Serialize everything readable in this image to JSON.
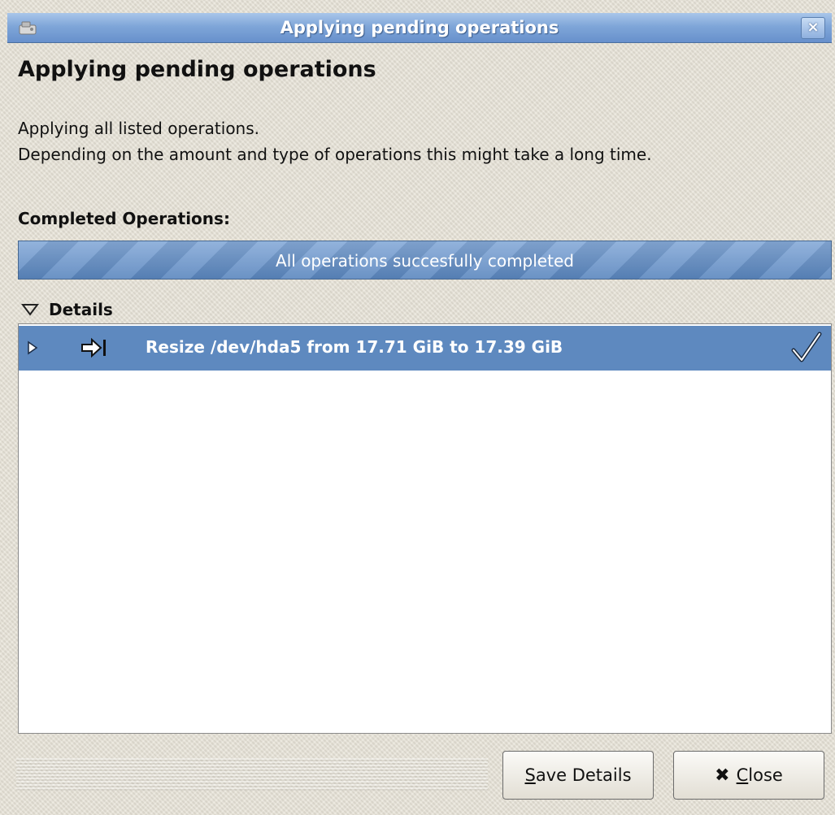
{
  "window": {
    "title": "Applying pending operations",
    "close_label": "×"
  },
  "dialog": {
    "heading": "Applying pending operations",
    "description_line1": "Applying all listed operations.",
    "description_line2": "Depending on the amount and type of operations this might take a long time."
  },
  "completed": {
    "label": "Completed Operations:",
    "progress_text": "All operations succesfully completed",
    "progress_fraction": 1.0
  },
  "details": {
    "label": "Details",
    "expanded": true,
    "operations": [
      {
        "text": "Resize /dev/hda5 from 17.71 GiB to 17.39 GiB",
        "status": "completed",
        "icon": "resize-move-icon",
        "status_icon": "checkmark-icon",
        "selected": true
      }
    ]
  },
  "buttons": {
    "save_details": {
      "mnemonic": "S",
      "rest": "ave Details"
    },
    "close": {
      "icon": "close-x-icon",
      "mnemonic": "C",
      "rest": "lose"
    }
  },
  "colors": {
    "titlebar": "#7fa6d8",
    "selection": "#5e89bf",
    "progress": "#5f8ac0",
    "dialog_bg": "#e6e2d6"
  }
}
